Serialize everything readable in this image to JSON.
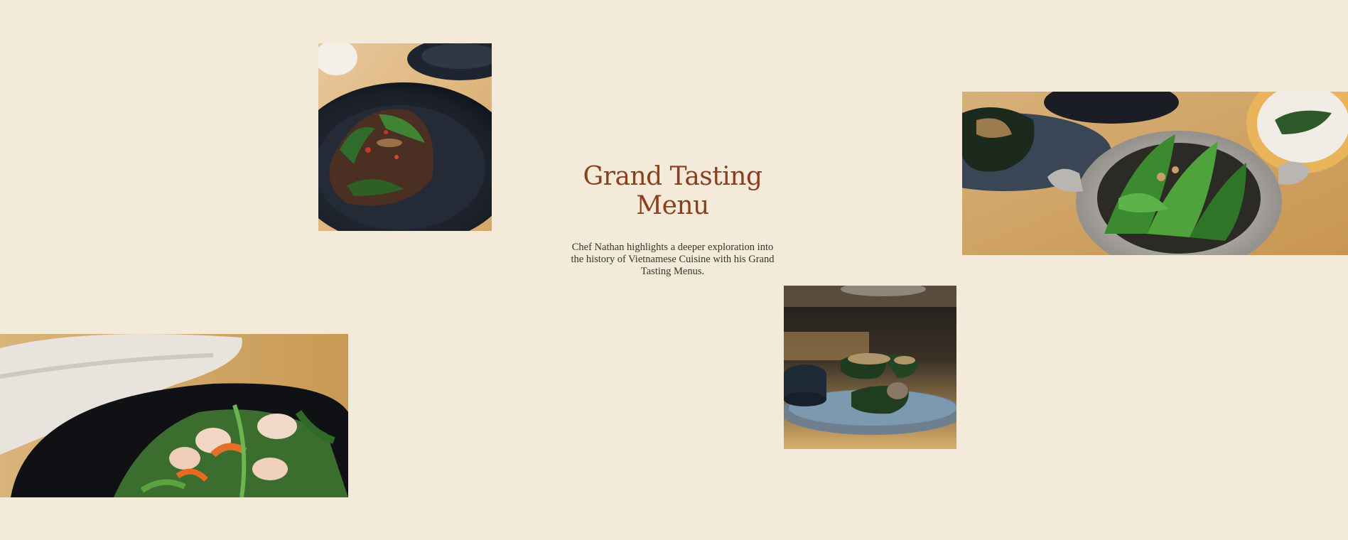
{
  "section": {
    "title": "Grand Tasting Menu",
    "description": "Chef Nathan highlights a deeper exploration into the history of Vietnamese Cuisine with his Grand Tasting Menus."
  },
  "images": [
    {
      "subject": "stir-fried beef with herbs in dark bowl"
    },
    {
      "subject": "herb salad in clay pot"
    },
    {
      "subject": "betel leaf wrapped rolls on blue plate"
    },
    {
      "subject": "prawn salad in black bowl"
    }
  ],
  "colors": {
    "background": "#f3ead9",
    "title": "#8a3f1e",
    "body_text": "#3b332b"
  }
}
